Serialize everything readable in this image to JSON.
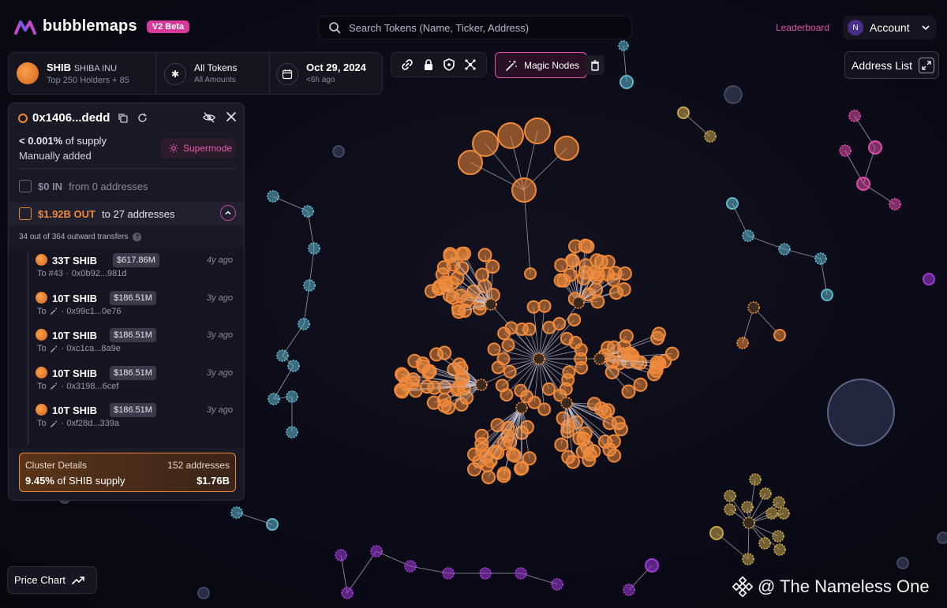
{
  "app": {
    "name": "bubblemaps",
    "badge": "V2 Beta"
  },
  "header": {
    "search_placeholder": "Search Tokens (Name, Ticker, Address)",
    "leaderboard": "Leaderboard",
    "account_initial": "N",
    "account_label": "Account"
  },
  "token": {
    "ticker": "SHIB",
    "full_name": "SHIBA INU",
    "holders": "Top 250 Holders + 85",
    "filter_label": "All Tokens",
    "filter_sub": "All Amounts",
    "date": "Oct 29, 2024",
    "date_sub": "<6h ago"
  },
  "tools": {
    "icons": [
      "link-icon",
      "lock-icon",
      "shield-icon",
      "network-icon"
    ],
    "magic_label": "Magic Nodes",
    "address_list": "Address List"
  },
  "panel": {
    "address": "0x1406...dedd",
    "supply_value": "< 0.001%",
    "supply_suffix": " of supply",
    "manual": "Manually added",
    "supermode": "Supermode",
    "in_amount": "$0 IN",
    "in_suffix": "from 0 addresses",
    "out_amount": "$1.92B OUT",
    "out_suffix": "to 27 addresses",
    "transfers_note": "34 out of 364 outward transfers",
    "transfers": [
      {
        "amount": "33T SHIB",
        "usd": "$617.86M",
        "ago": "4y ago",
        "to_prefix": "To #43 · ",
        "to_addr": "0x0b92...981d",
        "magic": false
      },
      {
        "amount": "10T SHIB",
        "usd": "$186.51M",
        "ago": "3y ago",
        "to_prefix": "To ",
        "to_addr": "· 0x99c1...0e76",
        "magic": true
      },
      {
        "amount": "10T SHIB",
        "usd": "$186.51M",
        "ago": "3y ago",
        "to_prefix": "To ",
        "to_addr": "· 0xc1ca...8a9e",
        "magic": true
      },
      {
        "amount": "10T SHIB",
        "usd": "$186.51M",
        "ago": "3y ago",
        "to_prefix": "To ",
        "to_addr": "· 0x3198...6cef",
        "magic": true
      },
      {
        "amount": "10T SHIB",
        "usd": "$186.51M",
        "ago": "3y ago",
        "to_prefix": "To ",
        "to_addr": "· 0xf28d...339a",
        "magic": true
      }
    ],
    "cluster_title": "Cluster Details",
    "cluster_count": "152 addresses",
    "cluster_share_value": "9.45%",
    "cluster_share_suffix": " of SHIB supply",
    "cluster_value": "$1.76B"
  },
  "footer": {
    "price_chart": "Price Chart",
    "watermark": "@ The Nameless One"
  },
  "colors": {
    "orange": "#f08a3a",
    "pink": "#e04aa8",
    "teal": "#5fb6cc",
    "purple": "#a23ad8",
    "gold": "#c9a54a"
  }
}
